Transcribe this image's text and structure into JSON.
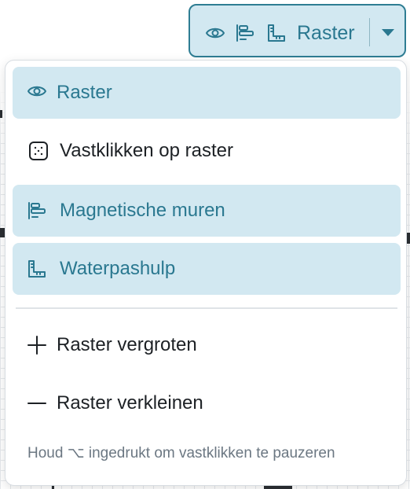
{
  "toolbar": {
    "label": "Raster",
    "icons": [
      "eye-icon",
      "align-lines-icon",
      "ruler-corner-icon"
    ],
    "dropdown_icon": "caret-down-icon",
    "accent": "#2a7890",
    "active_bg": "#d2e8f1"
  },
  "menu": {
    "items": [
      {
        "label": "Raster",
        "icon": "eye-icon",
        "active": true
      },
      {
        "label": "Vastklikken op raster",
        "icon": "snap-grid-icon",
        "active": false
      },
      {
        "label": "Magnetische muren",
        "icon": "align-lines-icon",
        "active": true
      },
      {
        "label": "Waterpashulp",
        "icon": "ruler-corner-icon",
        "active": true
      },
      {
        "label": "Raster vergroten",
        "icon": "plus-icon",
        "active": false
      },
      {
        "label": "Raster verkleinen",
        "icon": "minus-icon",
        "active": false
      }
    ],
    "hint": "Houd ⌥ ingedrukt om vastklikken te pauzeren"
  }
}
